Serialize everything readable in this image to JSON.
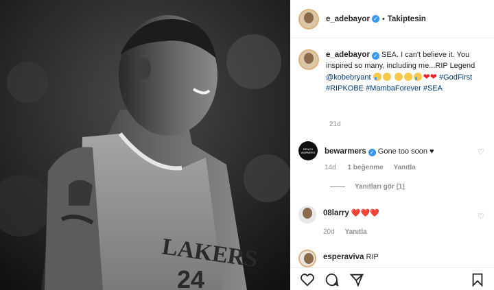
{
  "post": {
    "username": "e_adebayor",
    "verified_mark": "✓",
    "separator": "•",
    "follow_status": "Takiptesin"
  },
  "caption": {
    "username": "e_adebayor",
    "text_1": "SEA. I can't believe it. You inspired so many, including me...RIP Legend",
    "mention": "@kobebryant",
    "tag_1": "#GodFirst",
    "tag_2": "#RIPKOBE",
    "tag_3": "#MambaForever",
    "tag_4": "#SEA",
    "hearts": "❤",
    "time": "21d"
  },
  "photo": {
    "jersey_text": "LAKERS"
  },
  "comments": [
    {
      "username": "bewarmers",
      "avatar_text": "BENCH WARMERS",
      "text": "Gone too soon ♥",
      "time": "14d",
      "likes": "1 beğenme",
      "reply": "Yanıtla",
      "view_replies": "Yanıtları gör (1)"
    },
    {
      "username": "08larry",
      "text": "❤️❤️❤️",
      "time": "20d",
      "reply": "Yanıtla"
    },
    {
      "username": "esperaviva",
      "text": "RIP"
    }
  ],
  "icons": {
    "like": "heart-outline-icon",
    "comment": "comment-bubble-icon",
    "share": "paper-plane-icon",
    "save": "bookmark-icon"
  }
}
